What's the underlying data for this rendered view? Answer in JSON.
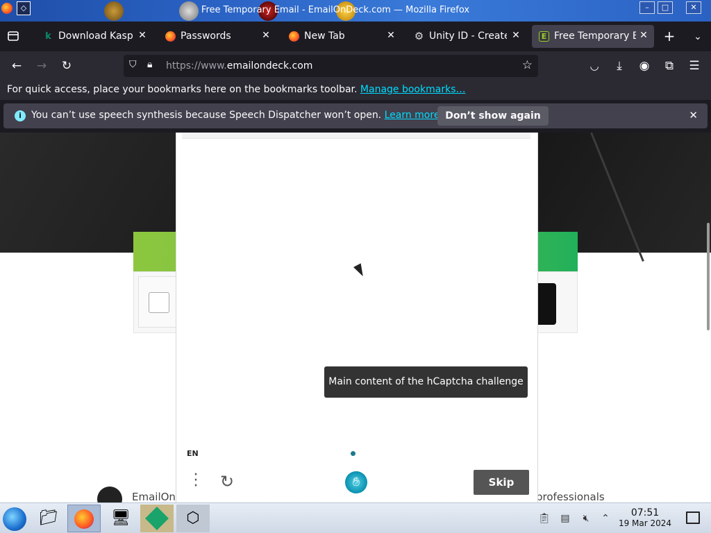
{
  "window": {
    "title": "Free Temporary Email - EmailOnDeck.com — Mozilla Firefox",
    "controls": {
      "minimize": "–",
      "maximize": "□",
      "close": "✕"
    }
  },
  "tabs": [
    {
      "label": "Download Kaspers",
      "favicon": "kaspersky-icon",
      "active": false
    },
    {
      "label": "Passwords",
      "favicon": "firefox-icon",
      "active": false
    },
    {
      "label": "New Tab",
      "favicon": "firefox-icon",
      "active": false
    },
    {
      "label": "Unity ID - Create a",
      "favicon": "unity-icon",
      "active": false
    },
    {
      "label": "Free Temporary Em",
      "favicon": "emailondeck-icon",
      "active": true
    }
  ],
  "navbar": {
    "url_prefix": "https://www.",
    "url_domain": "emailondeck.com"
  },
  "bookmarks": {
    "text": "For quick access, place your bookmarks here on the bookmarks toolbar.",
    "link": "Manage bookmarks…"
  },
  "notification": {
    "message": "You can’t use speech synthesis because Speech Dispatcher won’t open.",
    "learn_more": "Learn more",
    "dont_show": "Don’t show again"
  },
  "captcha": {
    "tooltip": "Main content of the hCaptcha challenge",
    "language": "EN",
    "skip": "Skip"
  },
  "page": {
    "footer_left": "EmailOnl",
    "footer_right": "professionals"
  },
  "taskbar": {
    "time": "07:51",
    "date": "19 Mar 2024"
  },
  "colors": {
    "tab_bar": "#1c1b22",
    "nav_bar": "#2b2a33",
    "accent_link": "#00ddff",
    "green_bar": "#7dc242",
    "captcha_dot": "#1c7b8c"
  }
}
